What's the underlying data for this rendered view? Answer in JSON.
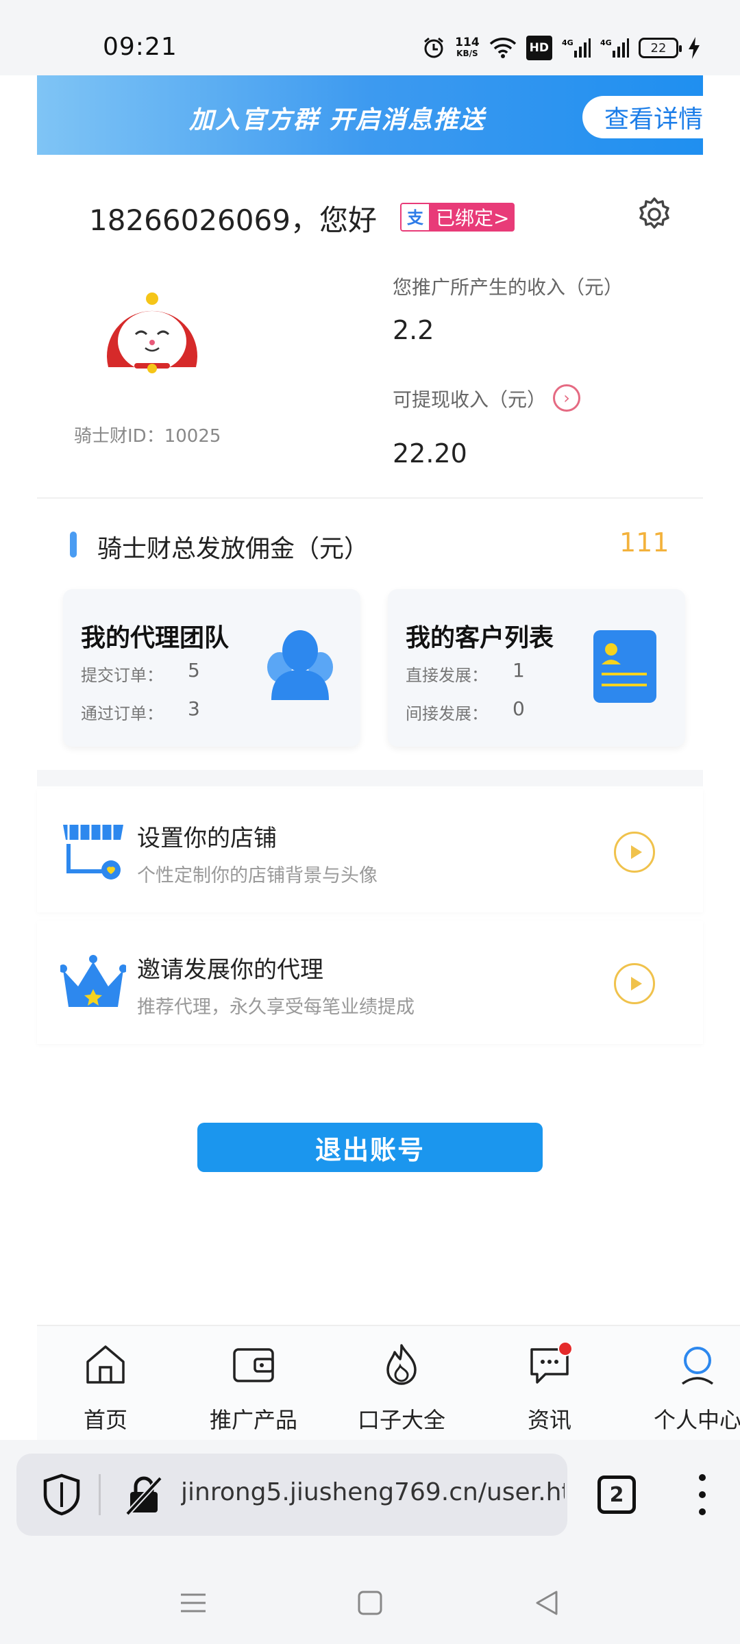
{
  "status_bar": {
    "time": "09:21",
    "net_speed_value": "114",
    "net_speed_unit": "KB/S",
    "hd_label": "HD",
    "battery": "22",
    "icons": [
      "alarm-icon",
      "wifi-icon",
      "signal-4g-icon",
      "signal-4g-icon",
      "battery-icon",
      "charging-icon"
    ]
  },
  "banner": {
    "text": "加入官方群  开启消息推送",
    "button_label": "查看详情"
  },
  "profile": {
    "greeting": "18266026069，您好",
    "bound_label": "已绑定>",
    "user_id": "骑士财ID：10025",
    "promo_income_label": "您推广所产生的收入（元）",
    "promo_income_value": "2.2",
    "withdrawable_label": "可提现收入（元）",
    "withdrawable_value": "22.20",
    "chevron": "›"
  },
  "commission": {
    "label": "骑士财总发放佣金（元）",
    "value": "111"
  },
  "cards": {
    "team": {
      "title": "我的代理团队",
      "row1_key": "提交订单：",
      "row1_value": "5",
      "row2_key": "通过订单：",
      "row2_value": "3"
    },
    "customers": {
      "title": "我的客户列表",
      "row1_key": "直接发展：",
      "row1_value": "1",
      "row2_key": "间接发展：",
      "row2_value": "0"
    }
  },
  "features": {
    "shop": {
      "title": "设置你的店铺",
      "subtitle": "个性定制你的店铺背景与头像"
    },
    "invite": {
      "title": "邀请发展你的代理",
      "subtitle": "推荐代理，永久享受每笔业绩提成"
    }
  },
  "logout_label": "退出账号",
  "bottom_nav": [
    {
      "label": "首页",
      "icon": "home-icon"
    },
    {
      "label": "推广产品",
      "icon": "wallet-icon"
    },
    {
      "label": "口子大全",
      "icon": "flame-icon"
    },
    {
      "label": "资讯",
      "icon": "chat-icon"
    },
    {
      "label": "个人中心",
      "icon": "person-icon"
    }
  ],
  "browser": {
    "url": "jinrong5.jiusheng769.cn/user.ht",
    "tab_count": "2"
  },
  "colors": {
    "accent_blue": "#1b96ee",
    "commission_gold": "#f3b23c",
    "badge_pink": "#e83b78"
  }
}
